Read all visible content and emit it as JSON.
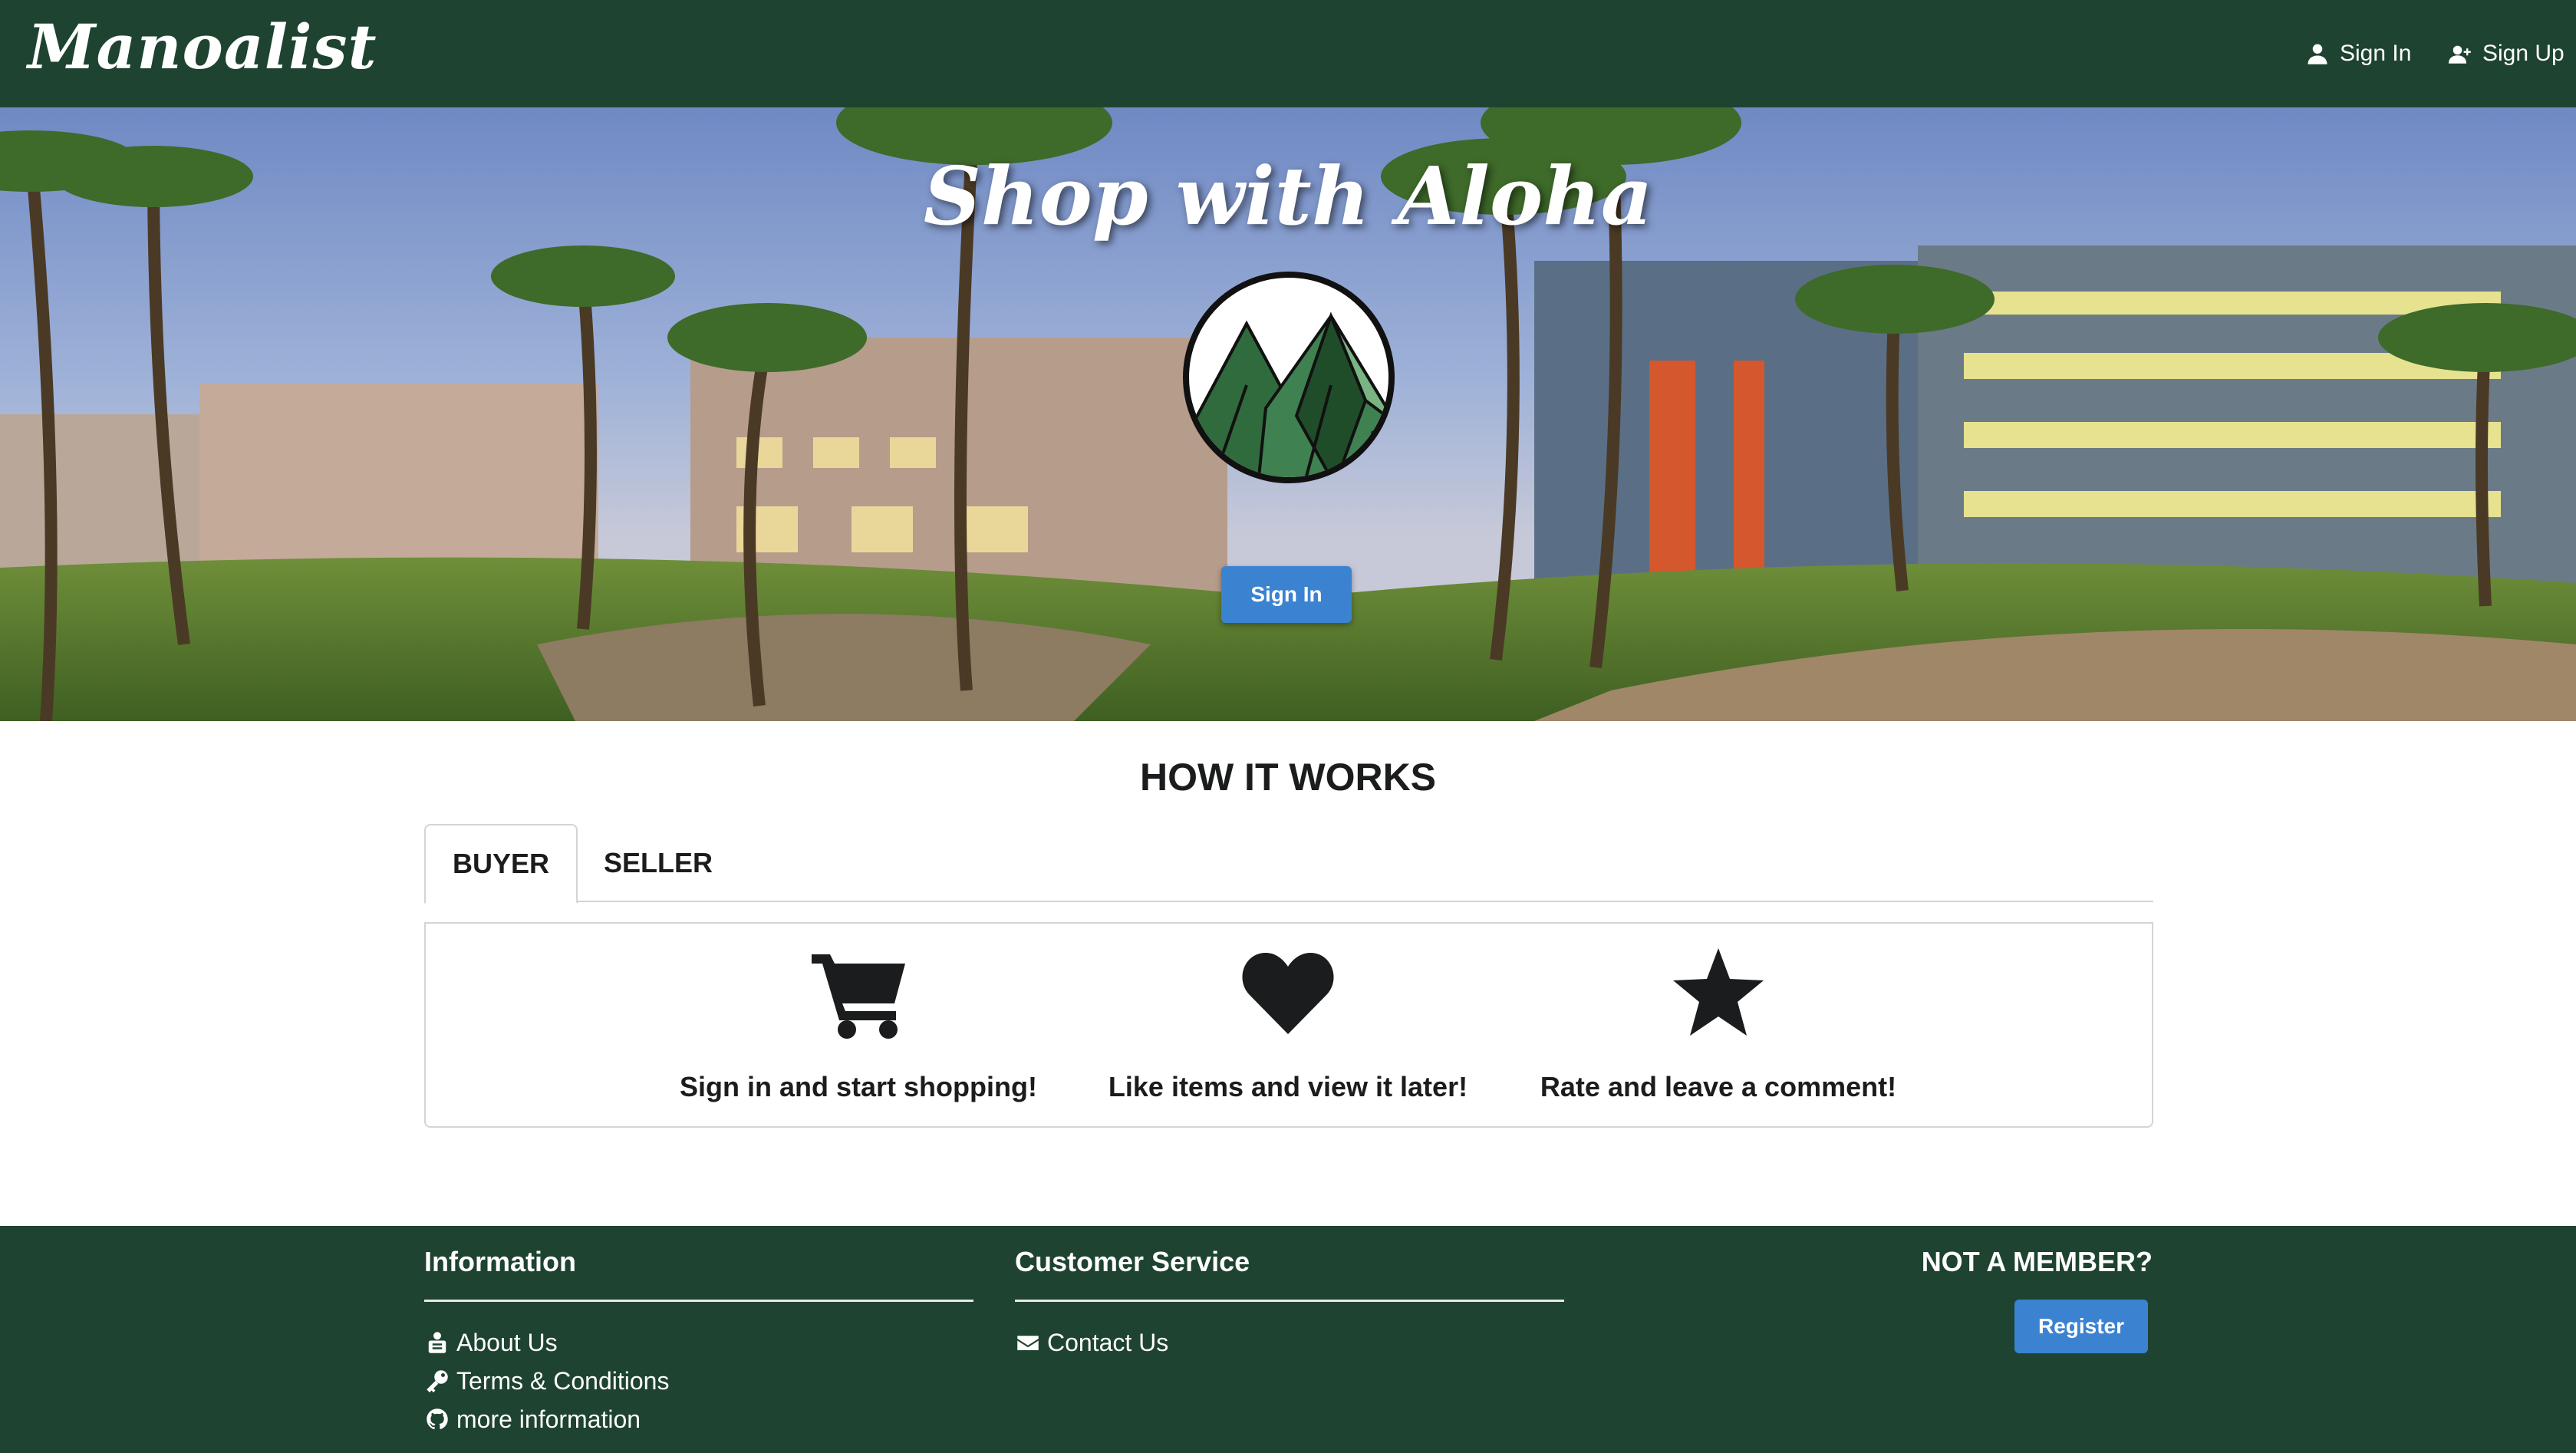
{
  "navbar": {
    "brand": "Manoalist",
    "sign_in": "Sign In",
    "sign_up": "Sign Up"
  },
  "hero": {
    "title": "Shop with Aloha",
    "button": "Sign In"
  },
  "how_it_works": {
    "title": "HOW IT WORKS",
    "tabs": [
      {
        "label": "BUYER",
        "active": true
      },
      {
        "label": "SELLER",
        "active": false
      }
    ],
    "features": [
      {
        "icon": "shopping-cart-icon",
        "text": "Sign in and start shopping!"
      },
      {
        "icon": "heart-icon",
        "text": "Like items and view it later!"
      },
      {
        "icon": "star-icon",
        "text": "Rate and leave a comment!"
      }
    ]
  },
  "footer": {
    "information": {
      "title": "Information",
      "links": [
        {
          "icon": "users-icon",
          "label": "About Us"
        },
        {
          "icon": "key-icon",
          "label": "Terms & Conditions"
        },
        {
          "icon": "github-icon",
          "label": "more information"
        }
      ]
    },
    "customer_service": {
      "title": "Customer Service",
      "links": [
        {
          "icon": "envelope-icon",
          "label": "Contact Us"
        }
      ]
    },
    "not_member": {
      "title": "NOT A MEMBER?",
      "button": "Register"
    }
  },
  "colors": {
    "brand_green": "#1e4330",
    "accent_blue": "#3b83d1"
  }
}
